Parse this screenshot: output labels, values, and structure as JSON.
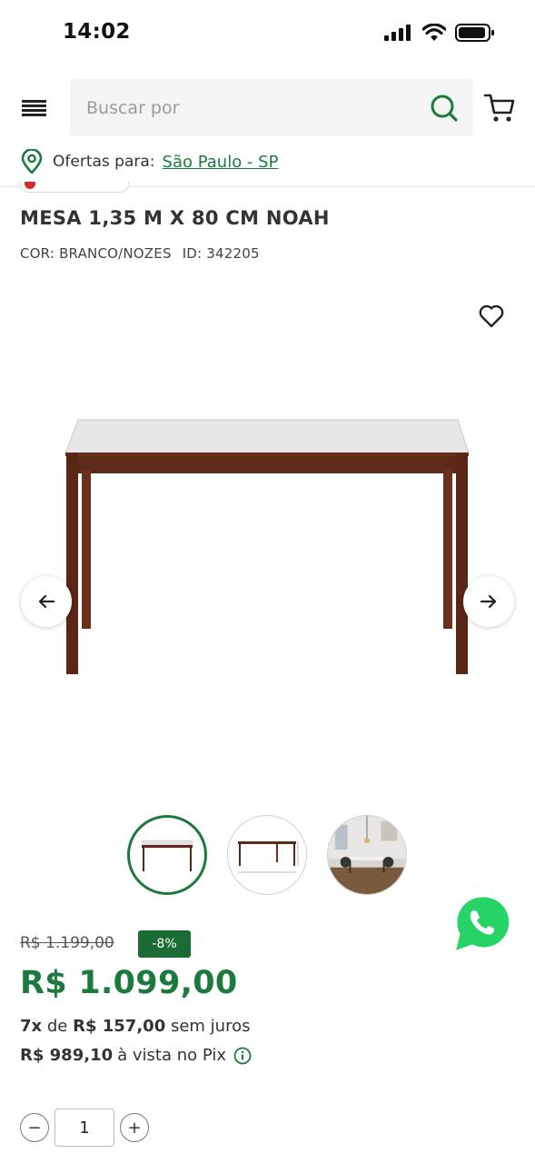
{
  "status_bar": {
    "time": "14:02"
  },
  "header": {
    "search_placeholder": "Buscar por",
    "icons": {
      "menu": "hamburger-menu-icon",
      "search": "search-icon",
      "cart": "cart-icon"
    }
  },
  "location": {
    "label": "Ofertas para:",
    "city": "São Paulo - SP"
  },
  "product": {
    "title": "MESA 1,35 M X 80 CM NOAH",
    "color": "COR: BRANCO/NOZES",
    "id": "ID: 342205",
    "thumbnail_count": 3,
    "active_thumbnail": 1
  },
  "pricing": {
    "old_price": "R$ 1.199,00",
    "discount": "-8%",
    "price": "R$ 1.099,00",
    "installment_count": "7x",
    "installment_connector": "de",
    "installment_value": "R$ 157,00",
    "installment_suffix": "sem juros",
    "pix_price": "R$ 989,10",
    "pix_suffix": "à vista no Pix"
  },
  "quantity": {
    "value": "1",
    "minus": "−",
    "plus": "+"
  },
  "colors": {
    "brand_green": "#1b7a3e",
    "discount_green": "#1b6b34",
    "whatsapp": "#25d366"
  }
}
